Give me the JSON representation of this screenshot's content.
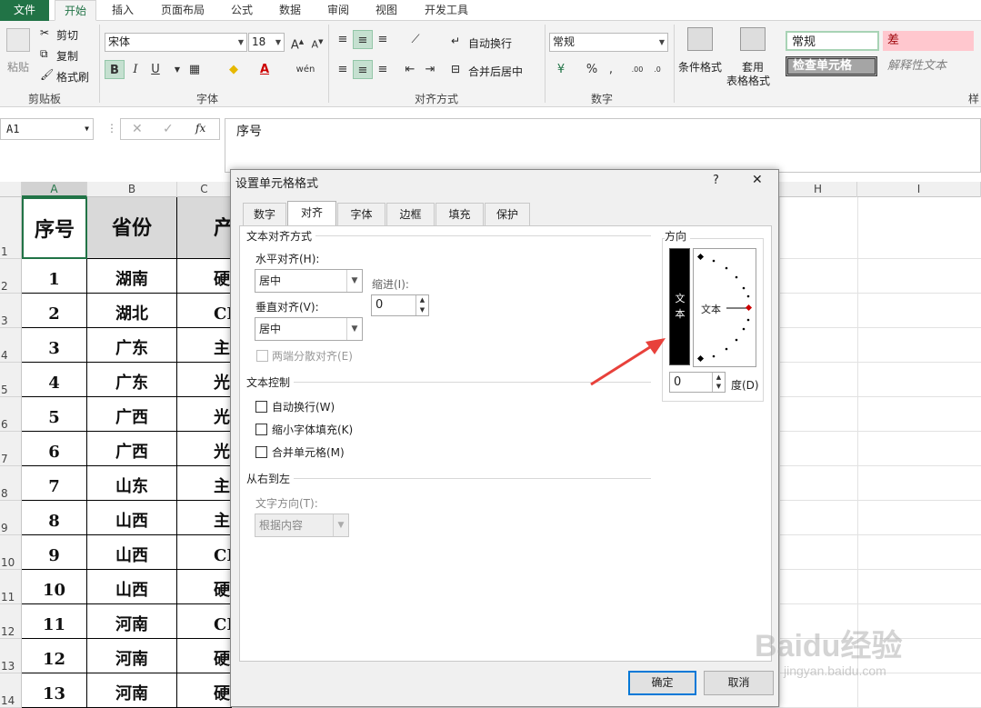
{
  "ribbon_tabs": [
    "文件",
    "开始",
    "插入",
    "页面布局",
    "公式",
    "数据",
    "审阅",
    "视图",
    "开发工具"
  ],
  "clipboard": {
    "paste": "粘贴",
    "cut": "剪切",
    "copy": "复制",
    "format_painter": "格式刷",
    "group": "剪贴板"
  },
  "font": {
    "name": "宋体",
    "size": "18",
    "group": "字体"
  },
  "alignment": {
    "wrap": "自动换行",
    "merge": "合并后居中",
    "group": "对齐方式"
  },
  "number": {
    "format": "常规",
    "group": "数字"
  },
  "styles_group": {
    "conditional_format": "条件格式",
    "table_format_line1": "套用",
    "table_format_line2": "表格格式",
    "normal": "常规",
    "bad": "差",
    "check_cell": "检查单元格",
    "explanatory": "解释性文本",
    "group_partial": "样"
  },
  "formula_bar": {
    "name_box": "A1",
    "fx": "fx",
    "content": "序号"
  },
  "columns": [
    "A",
    "B",
    "C",
    "H",
    "I"
  ],
  "row_numbers": [
    "1",
    "2",
    "3",
    "4",
    "5",
    "6",
    "7",
    "8",
    "9",
    "10",
    "11",
    "12",
    "13",
    "14"
  ],
  "table": {
    "headers": [
      "序号",
      "省份",
      "产"
    ],
    "rows": [
      [
        "1",
        "湖南",
        "硬"
      ],
      [
        "2",
        "湖北",
        "CP"
      ],
      [
        "3",
        "广东",
        "主"
      ],
      [
        "4",
        "广东",
        "光"
      ],
      [
        "5",
        "广西",
        "光"
      ],
      [
        "6",
        "广西",
        "光"
      ],
      [
        "7",
        "山东",
        "主"
      ],
      [
        "8",
        "山西",
        "主"
      ],
      [
        "9",
        "山西",
        "CP"
      ],
      [
        "10",
        "山西",
        "硬"
      ],
      [
        "11",
        "河南",
        "CP"
      ],
      [
        "12",
        "河南",
        "硬"
      ],
      [
        "13",
        "河南",
        "硬"
      ]
    ]
  },
  "dialog": {
    "title": "设置单元格格式",
    "help": "?",
    "close": "✕",
    "tabs": [
      "数字",
      "对齐",
      "字体",
      "边框",
      "填充",
      "保护"
    ],
    "text_alignment": "文本对齐方式",
    "horizontal_label": "水平对齐(H):",
    "horizontal_value": "居中",
    "indent_label": "缩进(I):",
    "indent_value": "0",
    "vertical_label": "垂直对齐(V):",
    "vertical_value": "居中",
    "justify_distributed": "两端分散对齐(E)",
    "text_control": "文本控制",
    "wrap_text": "自动换行(W)",
    "shrink_to_fit": "缩小字体填充(K)",
    "merge_cells": "合并单元格(M)",
    "rtl": "从右到左",
    "text_direction_label": "文字方向(T):",
    "text_direction_value": "根据内容",
    "orientation": "方向",
    "vertical_text": "文本",
    "angled_text": "文本",
    "degrees_value": "0",
    "degrees_label": "度(D)",
    "ok": "确定",
    "cancel": "取消"
  },
  "watermark": {
    "brand": "Baidu经验",
    "url": "jingyan.baidu.com"
  },
  "colors": {
    "excel_green": "#217346",
    "annotation_arrow": "#e8413b",
    "bad_fill": "#ffc7ce",
    "selected_header_fill": "#d9d9d9"
  }
}
